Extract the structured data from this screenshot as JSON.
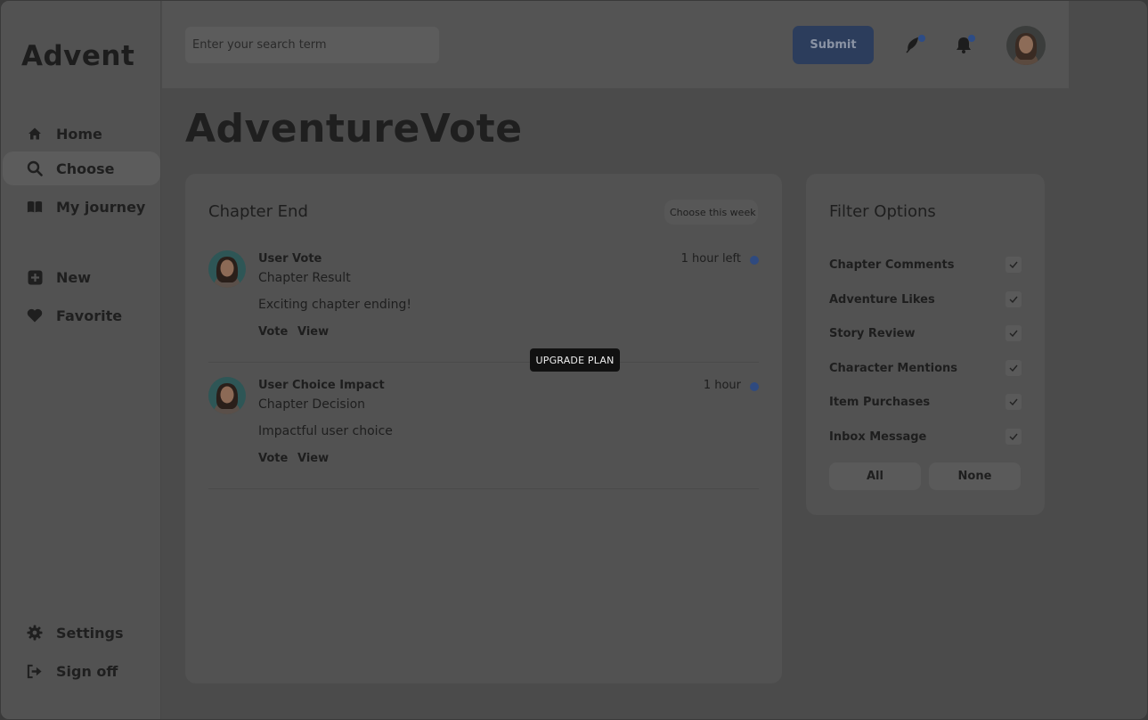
{
  "app": {
    "logo": "Advent"
  },
  "sidebar": {
    "items": [
      {
        "label": "Home",
        "icon": "home-icon"
      },
      {
        "label": "Choose",
        "icon": "search-icon",
        "active": true
      },
      {
        "label": "My journey",
        "icon": "book-icon"
      },
      {
        "label": "New",
        "icon": "plus-square-icon"
      },
      {
        "label": "Favorite",
        "icon": "heart-icon"
      },
      {
        "label": "Settings",
        "icon": "gear-icon"
      },
      {
        "label": "Sign off",
        "icon": "sign-out-icon"
      }
    ]
  },
  "topbar": {
    "search_placeholder": "Enter your search term",
    "submit_label": "Submit",
    "accent_color": "#2c3d5c"
  },
  "page": {
    "title": "AdventureVote"
  },
  "chapter": {
    "title": "Chapter End",
    "week_button": "Choose this week",
    "posts": [
      {
        "name": "User Vote",
        "subtitle": "Chapter Result",
        "body": "Exciting chapter ending!",
        "time": "1 hour left",
        "actions": [
          "Vote",
          "View"
        ]
      },
      {
        "name": "User Choice Impact",
        "subtitle": "Chapter Decision",
        "body": "Impactful user choice",
        "time": "1 hour",
        "actions": [
          "Vote",
          "View"
        ]
      }
    ]
  },
  "tooltip": {
    "label": "UPGRADE PLAN"
  },
  "filter": {
    "title": "Filter Options",
    "options": [
      {
        "label": "Chapter Comments",
        "checked": true
      },
      {
        "label": "Adventure Likes",
        "checked": true
      },
      {
        "label": "Story Review",
        "checked": true
      },
      {
        "label": "Character Mentions",
        "checked": true
      },
      {
        "label": "Item Purchases",
        "checked": true
      },
      {
        "label": "Inbox Message",
        "checked": true
      }
    ],
    "all_label": "All",
    "none_label": "None"
  }
}
